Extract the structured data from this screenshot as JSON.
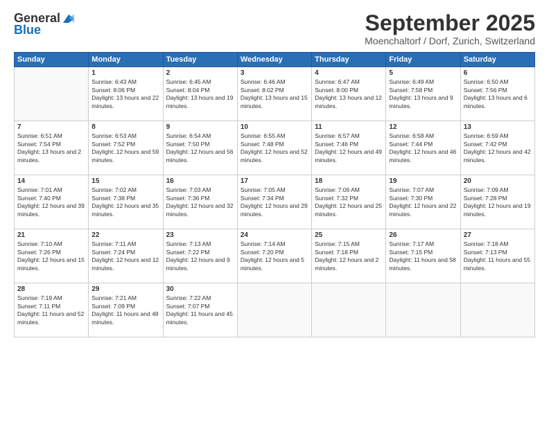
{
  "logo": {
    "general": "General",
    "blue": "Blue"
  },
  "title": "September 2025",
  "location": "Moenchaltorf / Dorf, Zurich, Switzerland",
  "days_of_week": [
    "Sunday",
    "Monday",
    "Tuesday",
    "Wednesday",
    "Thursday",
    "Friday",
    "Saturday"
  ],
  "weeks": [
    [
      {
        "num": "",
        "sunrise": "",
        "sunset": "",
        "daylight": ""
      },
      {
        "num": "1",
        "sunrise": "Sunrise: 6:43 AM",
        "sunset": "Sunset: 8:06 PM",
        "daylight": "Daylight: 13 hours and 22 minutes."
      },
      {
        "num": "2",
        "sunrise": "Sunrise: 6:45 AM",
        "sunset": "Sunset: 8:04 PM",
        "daylight": "Daylight: 13 hours and 19 minutes."
      },
      {
        "num": "3",
        "sunrise": "Sunrise: 6:46 AM",
        "sunset": "Sunset: 8:02 PM",
        "daylight": "Daylight: 13 hours and 15 minutes."
      },
      {
        "num": "4",
        "sunrise": "Sunrise: 6:47 AM",
        "sunset": "Sunset: 8:00 PM",
        "daylight": "Daylight: 13 hours and 12 minutes."
      },
      {
        "num": "5",
        "sunrise": "Sunrise: 6:49 AM",
        "sunset": "Sunset: 7:58 PM",
        "daylight": "Daylight: 13 hours and 9 minutes."
      },
      {
        "num": "6",
        "sunrise": "Sunrise: 6:50 AM",
        "sunset": "Sunset: 7:56 PM",
        "daylight": "Daylight: 13 hours and 6 minutes."
      }
    ],
    [
      {
        "num": "7",
        "sunrise": "Sunrise: 6:51 AM",
        "sunset": "Sunset: 7:54 PM",
        "daylight": "Daylight: 13 hours and 2 minutes."
      },
      {
        "num": "8",
        "sunrise": "Sunrise: 6:53 AM",
        "sunset": "Sunset: 7:52 PM",
        "daylight": "Daylight: 12 hours and 59 minutes."
      },
      {
        "num": "9",
        "sunrise": "Sunrise: 6:54 AM",
        "sunset": "Sunset: 7:50 PM",
        "daylight": "Daylight: 12 hours and 56 minutes."
      },
      {
        "num": "10",
        "sunrise": "Sunrise: 6:55 AM",
        "sunset": "Sunset: 7:48 PM",
        "daylight": "Daylight: 12 hours and 52 minutes."
      },
      {
        "num": "11",
        "sunrise": "Sunrise: 6:57 AM",
        "sunset": "Sunset: 7:46 PM",
        "daylight": "Daylight: 12 hours and 49 minutes."
      },
      {
        "num": "12",
        "sunrise": "Sunrise: 6:58 AM",
        "sunset": "Sunset: 7:44 PM",
        "daylight": "Daylight: 12 hours and 46 minutes."
      },
      {
        "num": "13",
        "sunrise": "Sunrise: 6:59 AM",
        "sunset": "Sunset: 7:42 PM",
        "daylight": "Daylight: 12 hours and 42 minutes."
      }
    ],
    [
      {
        "num": "14",
        "sunrise": "Sunrise: 7:01 AM",
        "sunset": "Sunset: 7:40 PM",
        "daylight": "Daylight: 12 hours and 39 minutes."
      },
      {
        "num": "15",
        "sunrise": "Sunrise: 7:02 AM",
        "sunset": "Sunset: 7:38 PM",
        "daylight": "Daylight: 12 hours and 35 minutes."
      },
      {
        "num": "16",
        "sunrise": "Sunrise: 7:03 AM",
        "sunset": "Sunset: 7:36 PM",
        "daylight": "Daylight: 12 hours and 32 minutes."
      },
      {
        "num": "17",
        "sunrise": "Sunrise: 7:05 AM",
        "sunset": "Sunset: 7:34 PM",
        "daylight": "Daylight: 12 hours and 29 minutes."
      },
      {
        "num": "18",
        "sunrise": "Sunrise: 7:06 AM",
        "sunset": "Sunset: 7:32 PM",
        "daylight": "Daylight: 12 hours and 25 minutes."
      },
      {
        "num": "19",
        "sunrise": "Sunrise: 7:07 AM",
        "sunset": "Sunset: 7:30 PM",
        "daylight": "Daylight: 12 hours and 22 minutes."
      },
      {
        "num": "20",
        "sunrise": "Sunrise: 7:09 AM",
        "sunset": "Sunset: 7:28 PM",
        "daylight": "Daylight: 12 hours and 19 minutes."
      }
    ],
    [
      {
        "num": "21",
        "sunrise": "Sunrise: 7:10 AM",
        "sunset": "Sunset: 7:26 PM",
        "daylight": "Daylight: 12 hours and 15 minutes."
      },
      {
        "num": "22",
        "sunrise": "Sunrise: 7:11 AM",
        "sunset": "Sunset: 7:24 PM",
        "daylight": "Daylight: 12 hours and 12 minutes."
      },
      {
        "num": "23",
        "sunrise": "Sunrise: 7:13 AM",
        "sunset": "Sunset: 7:22 PM",
        "daylight": "Daylight: 12 hours and 9 minutes."
      },
      {
        "num": "24",
        "sunrise": "Sunrise: 7:14 AM",
        "sunset": "Sunset: 7:20 PM",
        "daylight": "Daylight: 12 hours and 5 minutes."
      },
      {
        "num": "25",
        "sunrise": "Sunrise: 7:15 AM",
        "sunset": "Sunset: 7:18 PM",
        "daylight": "Daylight: 12 hours and 2 minutes."
      },
      {
        "num": "26",
        "sunrise": "Sunrise: 7:17 AM",
        "sunset": "Sunset: 7:15 PM",
        "daylight": "Daylight: 11 hours and 58 minutes."
      },
      {
        "num": "27",
        "sunrise": "Sunrise: 7:18 AM",
        "sunset": "Sunset: 7:13 PM",
        "daylight": "Daylight: 11 hours and 55 minutes."
      }
    ],
    [
      {
        "num": "28",
        "sunrise": "Sunrise: 7:19 AM",
        "sunset": "Sunset: 7:11 PM",
        "daylight": "Daylight: 11 hours and 52 minutes."
      },
      {
        "num": "29",
        "sunrise": "Sunrise: 7:21 AM",
        "sunset": "Sunset: 7:09 PM",
        "daylight": "Daylight: 11 hours and 48 minutes."
      },
      {
        "num": "30",
        "sunrise": "Sunrise: 7:22 AM",
        "sunset": "Sunset: 7:07 PM",
        "daylight": "Daylight: 11 hours and 45 minutes."
      },
      {
        "num": "",
        "sunrise": "",
        "sunset": "",
        "daylight": ""
      },
      {
        "num": "",
        "sunrise": "",
        "sunset": "",
        "daylight": ""
      },
      {
        "num": "",
        "sunrise": "",
        "sunset": "",
        "daylight": ""
      },
      {
        "num": "",
        "sunrise": "",
        "sunset": "",
        "daylight": ""
      }
    ]
  ]
}
